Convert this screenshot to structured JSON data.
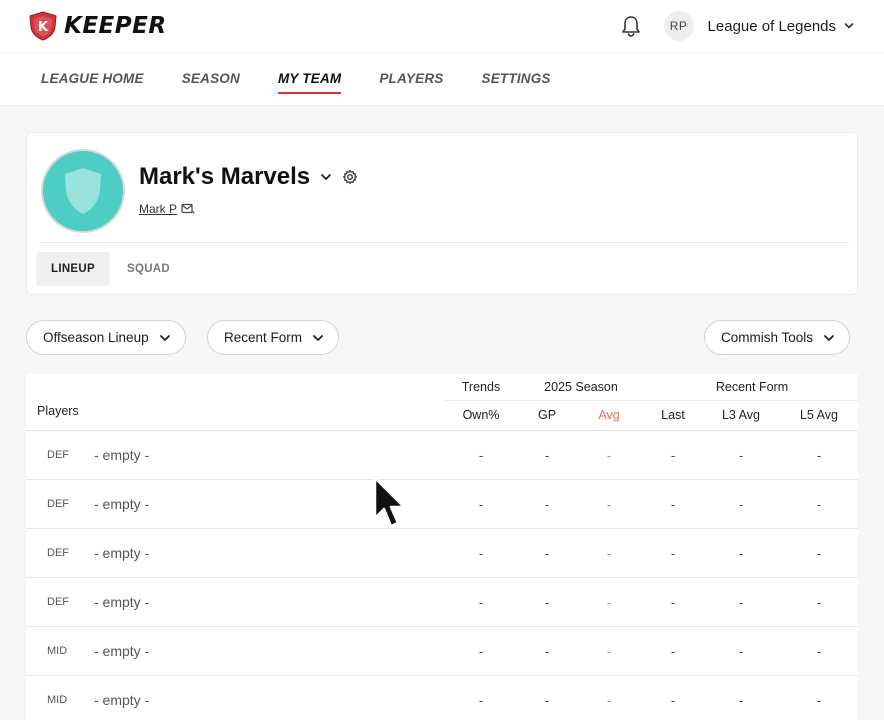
{
  "header": {
    "logo_text": "KEEPER",
    "user_initials": "RP",
    "league_name": "League of Legends"
  },
  "nav": {
    "items": [
      "LEAGUE HOME",
      "SEASON",
      "MY TEAM",
      "PLAYERS",
      "SETTINGS"
    ],
    "active": "MY TEAM"
  },
  "team": {
    "name": "Mark's Marvels",
    "owner": "Mark P",
    "tabs": [
      "LINEUP",
      "SQUAD"
    ],
    "active_tab": "LINEUP"
  },
  "controls": {
    "lineup_select": "Offseason Lineup",
    "form_select": "Recent Form",
    "commish_tools": "Commish Tools"
  },
  "table": {
    "groups": [
      "Trends",
      "2025 Season",
      "Recent Form"
    ],
    "players_header": "Players",
    "columns": [
      "Own%",
      "GP",
      "Avg",
      "Last",
      "L3 Avg",
      "L5 Avg"
    ],
    "rows": [
      {
        "pos": "DEF",
        "name": "- empty -",
        "values": [
          "-",
          "-",
          "-",
          "-",
          "-",
          "-"
        ]
      },
      {
        "pos": "DEF",
        "name": "- empty -",
        "values": [
          "-",
          "-",
          "-",
          "-",
          "-",
          "-"
        ]
      },
      {
        "pos": "DEF",
        "name": "- empty -",
        "values": [
          "-",
          "-",
          "-",
          "-",
          "-",
          "-"
        ]
      },
      {
        "pos": "DEF",
        "name": "- empty -",
        "values": [
          "-",
          "-",
          "-",
          "-",
          "-",
          "-"
        ]
      },
      {
        "pos": "MID",
        "name": "- empty -",
        "values": [
          "-",
          "-",
          "-",
          "-",
          "-",
          "-"
        ]
      },
      {
        "pos": "MID",
        "name": "- empty -",
        "values": [
          "-",
          "-",
          "-",
          "-",
          "-",
          "-"
        ]
      }
    ]
  },
  "colors": {
    "accent_red": "#d6343c",
    "highlight_orange": "#e8734a",
    "team_teal": "#4ecdc4"
  }
}
